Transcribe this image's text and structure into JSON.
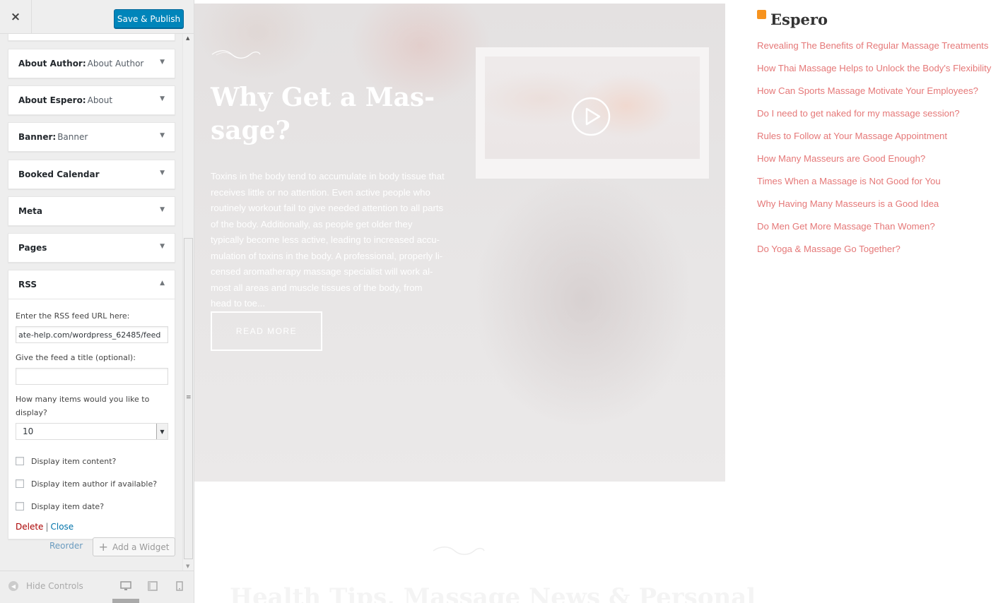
{
  "customizer": {
    "close_label": "×",
    "publish_label": "Save & Publish",
    "widgets": [
      {
        "name": "About Author:",
        "title": "About Author"
      },
      {
        "name": "About Espero:",
        "title": "About"
      },
      {
        "name": "Banner:",
        "title": "Banner"
      },
      {
        "name": "Booked Calendar",
        "title": ""
      },
      {
        "name": "Meta",
        "title": ""
      },
      {
        "name": "Pages",
        "title": ""
      },
      {
        "name": "RSS",
        "title": ""
      }
    ],
    "rss_form": {
      "url_label": "Enter the RSS feed URL here:",
      "url_value": "ate-help.com/wordpress_62485/feed",
      "title_label": "Give the feed a title (optional):",
      "title_value": "",
      "items_label": "How many items would you like to display?",
      "items_value": "10",
      "opt_content": "Display item content?",
      "opt_author": "Display item author if available?",
      "opt_date": "Display item date?",
      "delete_label": "Delete",
      "separator": "|",
      "close_label": "Close"
    },
    "reorder_label": "Reorder",
    "add_widget_label": "Add a Widget",
    "hide_controls_label": "Hide Controls"
  },
  "hero": {
    "title": "Why Get a Mas­sage?",
    "text": "Toxins in the body tend to accumulate in body tissue that receives little or no attention. Even active people who routinely workout fail to give needed attention to all parts of the body. Additionally, as people get older they typically become less active, leading to increased accu­mulation of toxins in the body. A professional, properly li­censed aromatherapy massage specialist will work al­most all areas and muscle tissues of the body, from head to toe...",
    "button_label": "READ MORE"
  },
  "lower_section": {
    "heading": "Health Tips, Massage News & Personal"
  },
  "rss_widget": {
    "title": "Espero",
    "items": [
      "Revealing The Benefits of Regular Massage Treat­ments",
      "How Thai Massage Helps to Unlock the Body's Flexibility",
      "How Can Sports Massage Motivate Your Employees?",
      "Do I need to get naked for my massage session?",
      "Rules to Follow at Your Massage Appointment",
      "How Many Masseurs are Good Enough?",
      "Times When a Massage is Not Good for You",
      "Why Having Many Masseurs is a Good Idea",
      "Do Men Get More Massage Than Women?",
      "Do Yoga & Massage Go Together?"
    ]
  },
  "colors": {
    "publish": "#0085ba",
    "link_pink": "#e57878",
    "delete_red": "#aa0000",
    "close_blue": "#0073aa",
    "rss_orange": "#f7931e"
  },
  "icons": {
    "close": "close-icon",
    "play": "play-icon",
    "rss": "rss-icon",
    "plus": "plus-icon",
    "desktop": "desktop-icon",
    "tablet": "tablet-icon",
    "mobile": "mobile-icon"
  }
}
